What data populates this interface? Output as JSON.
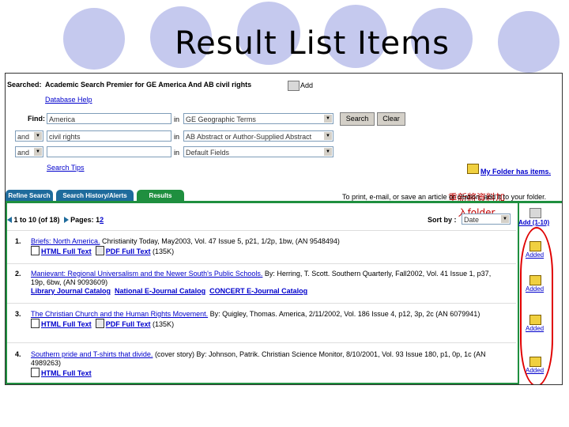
{
  "slide": {
    "title": "Result List Items",
    "note_line1": "重新將資料加",
    "note_line2": "入folder"
  },
  "search": {
    "searched_label": "Searched:",
    "searched_text": "Academic Search Premier for GE America And AB civil rights",
    "add_label": "Add",
    "database_help": "Database Help",
    "find_label": "Find:",
    "rows": [
      {
        "bool": "",
        "term": "America",
        "in": "in",
        "field": "GE Geographic Terms"
      },
      {
        "bool": "and",
        "term": "civil rights",
        "in": "in",
        "field": "AB Abstract or Author-Supplied Abstract"
      },
      {
        "bool": "and",
        "term": "",
        "in": "in",
        "field": "Default Fields"
      }
    ],
    "search_button": "Search",
    "clear_button": "Clear",
    "search_tips": "Search Tips",
    "folder_link": "My Folder has items."
  },
  "tabs": [
    "Refine Search",
    "Search History/Alerts",
    "Results"
  ],
  "results_bar": {
    "instruction": "To print, e-mail, or save an article or citation, add it to your folder.",
    "range": "1 to 10",
    "of": "(of 18)",
    "pages_label": "Pages:",
    "page_current": "1",
    "page_link": "2",
    "sort_label": "Sort by :",
    "sort_value": "Date",
    "add_range": "Add (1-10)"
  },
  "results": [
    {
      "num": "1.",
      "title": "Briefs: North America.",
      "citation": " Christianity Today, May2003, Vol. 47 Issue 5, p21, 1/2p, 1bw, (AN 9548494)",
      "links": [
        "HTML Full Text",
        "PDF Full Text"
      ],
      "size": "(135K)",
      "status": "Added"
    },
    {
      "num": "2.",
      "title": "Manievant: Regional Universalism and the Newer South's Public Schools.",
      "citation": " By: Herring, T. Scott. Southern Quarterly, Fall2002, Vol. 41 Issue 1, p37, 19p, 6bw, (AN 9093609)",
      "links": [
        "Library Journal Catalog",
        "National E-Journal Catalog",
        "CONCERT E-Journal Catalog"
      ],
      "size": "",
      "status": "Added"
    },
    {
      "num": "3.",
      "title": "The Christian Church and the Human Rights Movement.",
      "citation": " By: Quigley, Thomas. America, 2/11/2002, Vol. 186 Issue 4, p12, 3p, 2c (AN 6079941)",
      "links": [
        "HTML Full Text",
        "PDF Full Text"
      ],
      "size": "(135K)",
      "status": "Added"
    },
    {
      "num": "4.",
      "title": "Southern pride and T-shirts that divide.",
      "citation": " (cover story) By: Johnson, Patrik. Christian Science Monitor, 8/10/2001, Vol. 93 Issue 180, p1, 0p, 1c (AN 4989263)",
      "links": [
        "HTML Full Text"
      ],
      "size": "",
      "status": "Added"
    }
  ]
}
